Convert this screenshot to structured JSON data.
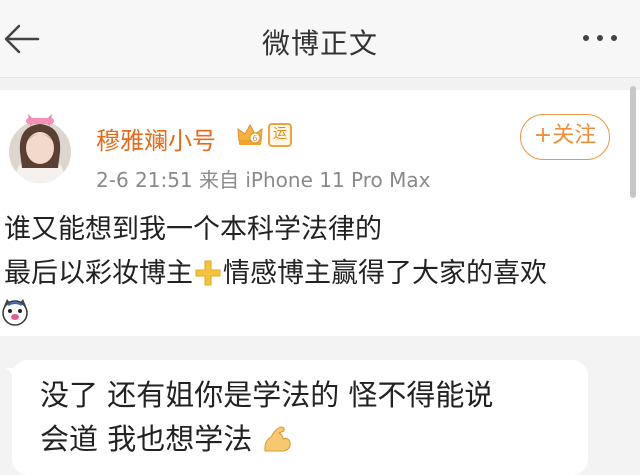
{
  "nav": {
    "title": "微博正文",
    "back_icon": "back-arrow-icon",
    "more_icon": "more-dots-icon"
  },
  "post": {
    "author": {
      "name": "穆雅斓小号",
      "verified_icon": "crown-icon",
      "badge": "运"
    },
    "meta": "2-6 21:51  来自 iPhone 11 Pro Max",
    "follow_label": "+关注",
    "text_line1": "谁又能想到我一个本科学法律的",
    "text_line2_a": "最后以彩妆博主",
    "text_line2_b": "情感博主赢得了大家的喜欢",
    "inline_icon": "yellow-plus-icon",
    "emoji_icon": "dog-emoji-icon"
  },
  "comment": {
    "line1": "没了 还有姐你是学法的 怪不得能说",
    "line2": "会道 我也想学法",
    "emoji_icon": "flexed-biceps-icon"
  },
  "colors": {
    "accent": "#ef8f3d",
    "username": "#e86a1a",
    "text": "#222222",
    "meta": "#8a8a8a"
  }
}
